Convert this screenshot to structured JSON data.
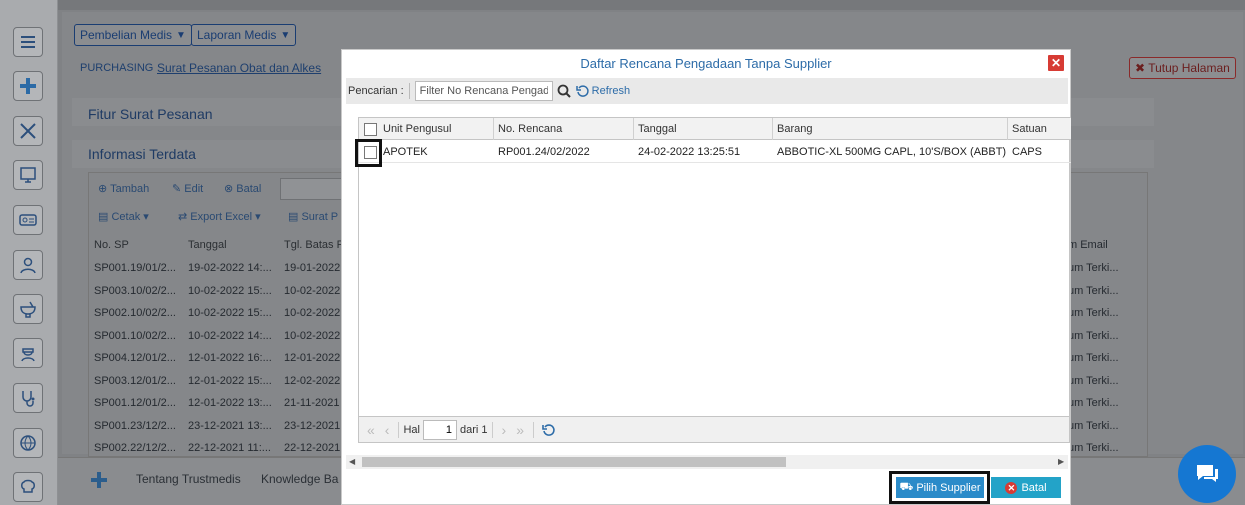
{
  "menus": {
    "pembelian": "Pembelian Medis",
    "laporan": "Laporan Medis"
  },
  "breadcrumb": {
    "section": "PURCHASING",
    "page": "Surat Pesanan Obat dan Alkes"
  },
  "tutup_label": "Tutup Halaman",
  "sections": {
    "fitur": "Fitur Surat Pesanan",
    "informasi": "Informasi Terdata"
  },
  "bg_toolbar": {
    "tambah": "Tambah",
    "edit": "Edit",
    "batal": "Batal",
    "cetak": "Cetak",
    "export": "Export Excel",
    "surat": "Surat P"
  },
  "bg_table": {
    "headers": [
      "No. SP",
      "Tanggal",
      "Tgl. Batas P"
    ],
    "right_header": "m Email",
    "rows": [
      [
        "SP001.19/01/2...",
        "19-02-2022 14:...",
        "19-01-2022"
      ],
      [
        "SP003.10/02/2...",
        "10-02-2022 15:...",
        "10-02-2022"
      ],
      [
        "SP002.10/02/2...",
        "10-02-2022 15:...",
        "10-02-2022"
      ],
      [
        "SP001.10/02/2...",
        "10-02-2022 14:...",
        "10-02-2022"
      ],
      [
        "SP004.12/01/2...",
        "12-01-2022 16:...",
        "12-01-2022"
      ],
      [
        "SP003.12/01/2...",
        "12-01-2022 15:...",
        "12-02-2022"
      ],
      [
        "SP001.12/01/2...",
        "12-01-2022 13:...",
        "21-11-2021"
      ],
      [
        "SP001.23/12/2...",
        "23-12-2021 13:...",
        "23-12-2021"
      ],
      [
        "SP002.22/12/2...",
        "22-12-2021 11:...",
        "22-12-2021"
      ]
    ],
    "right_cell": "um Terki..."
  },
  "footer": {
    "tentang": "Tentang Trustmedis",
    "knowledge": "Knowledge Ba"
  },
  "modal": {
    "title": "Daftar Rencana Pengadaan Tanpa Supplier",
    "search_label": "Pencarian :",
    "search_placeholder": "Filter No Rencana Pengadaan",
    "refresh_label": "Refresh",
    "columns": [
      "Unit Pengusul",
      "No. Rencana",
      "Tanggal",
      "Barang",
      "Satuan"
    ],
    "rows": [
      {
        "unit": "APOTEK",
        "no": "RP001.24/02/2022",
        "tanggal": "24-02-2022 13:25:51",
        "barang": "ABBOTIC-XL 500MG CAPL, 10'S/BOX (ABBT)",
        "satuan": "CAPS"
      }
    ],
    "pager": {
      "hal_label": "Hal",
      "page": "1",
      "dari_label": "dari 1"
    },
    "pilih_label": "Pilih Supplier",
    "batal_label": "Batal"
  },
  "colors": {
    "modal_title": "#2d6ca8",
    "pilih_button": "#2b8bc9",
    "batal_button": "#23a3c8",
    "close_button": "#d73b34",
    "chat_button": "#1577d2"
  },
  "icons": [
    "menu-icon",
    "puzzle-icon",
    "tools-icon",
    "monitor-icon",
    "id-card-icon",
    "user-icon",
    "mortar-icon",
    "nurse-icon",
    "stethoscope-icon",
    "globe-icon",
    "brain-icon"
  ]
}
